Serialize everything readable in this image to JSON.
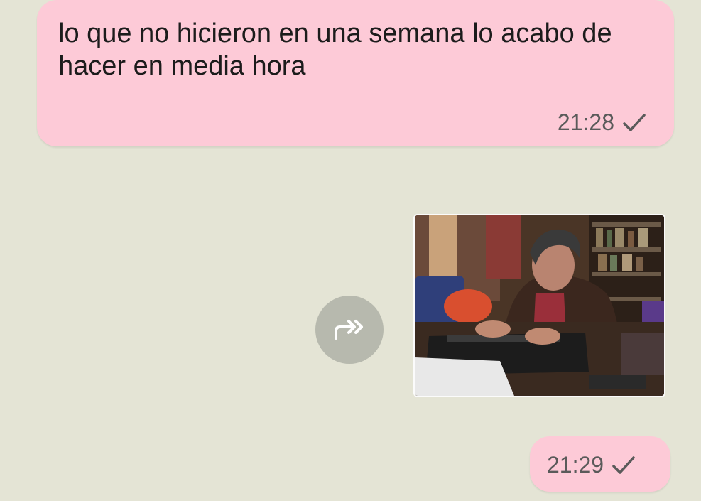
{
  "messages": [
    {
      "text": "lo que no hicieron en una semana lo acabo de hacer en media hora",
      "time": "21:28",
      "status": "sent-check-icon"
    },
    {
      "type": "gif",
      "media_description": "",
      "time": "21:29",
      "status": "sent-check-icon"
    }
  ],
  "colors": {
    "background": "#e4e4d5",
    "bubble": "#fdcad7",
    "forward_button": "#b7b9ae",
    "meta_text": "#5a5a5a"
  },
  "icons": {
    "forward": "forward-icon",
    "status": "check-icon"
  }
}
